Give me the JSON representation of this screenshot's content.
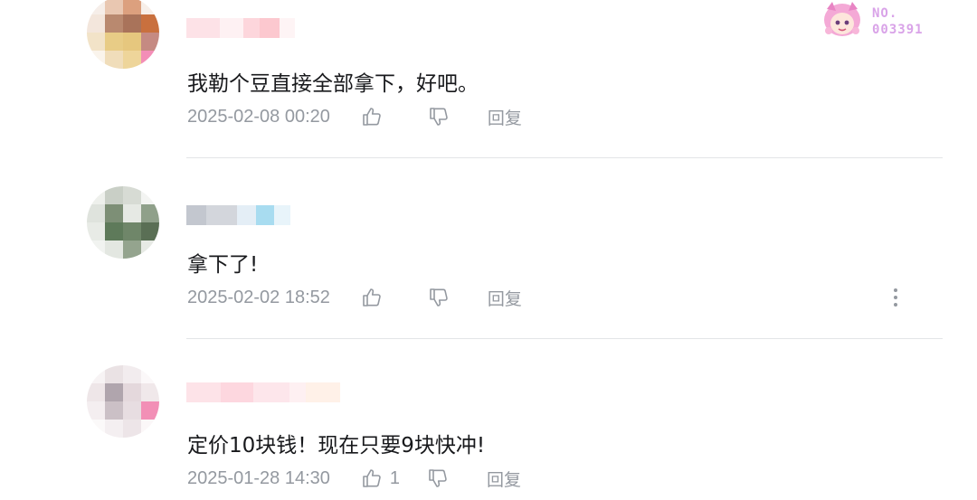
{
  "badge": {
    "label": "NO.",
    "number": "003391"
  },
  "comments": [
    {
      "text": "我勒个豆直接全部拿下，好吧。",
      "time": "2025-02-08 00:20",
      "like_count": "",
      "reply_label": "回复"
    },
    {
      "text": "拿下了!",
      "time": "2025-02-02 18:52",
      "like_count": "",
      "reply_label": "回复"
    },
    {
      "text": "定价10块钱！现在只要9块快冲!",
      "time": "2025-01-28 14:30",
      "like_count": "1",
      "reply_label": "回复"
    }
  ],
  "colors": {
    "text": "#18191c",
    "meta": "#9499a0",
    "divider": "#e3e5e7",
    "badge": "#d9a3e8"
  }
}
